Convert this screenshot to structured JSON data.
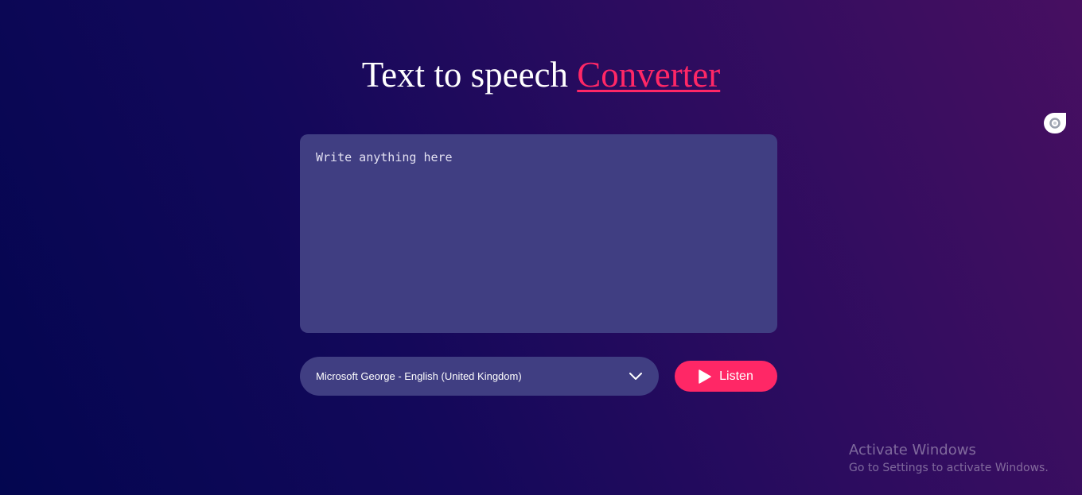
{
  "header": {
    "title_main": "Text to speech ",
    "title_accent": "Converter"
  },
  "editor": {
    "placeholder": "Write anything here",
    "value": ""
  },
  "voice_select": {
    "selected": "Microsoft George - English (United Kingdom)",
    "icon": "chevron-down-icon"
  },
  "listen_button": {
    "label": "Listen",
    "icon": "play-icon"
  },
  "browser_extension": {
    "icon": "extension-icon"
  },
  "os_watermark": {
    "title": "Activate Windows",
    "subtitle": "Go to Settings to activate Windows."
  },
  "colors": {
    "accent": "#ff2766",
    "panel": "#403e82",
    "background_start": "#030650",
    "background_end": "#470f61"
  }
}
